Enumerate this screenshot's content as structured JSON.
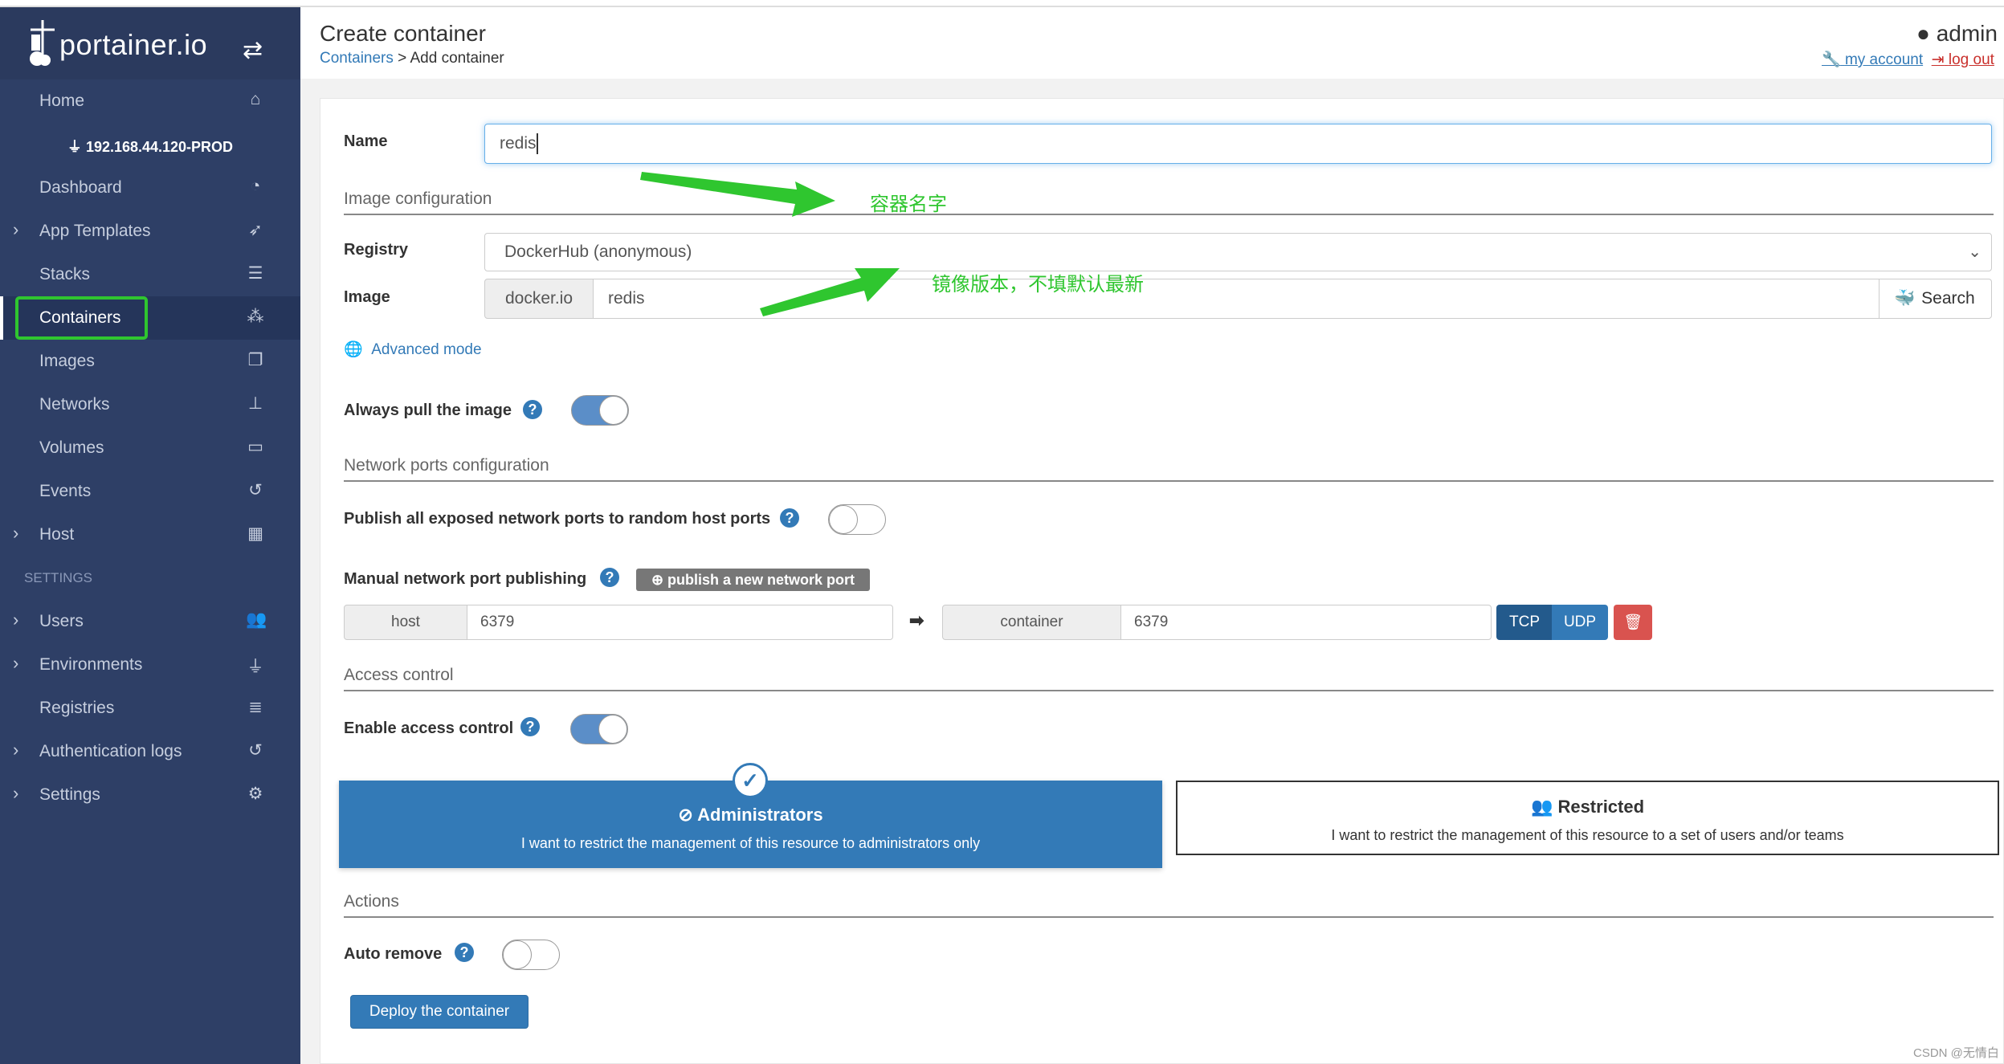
{
  "sidebar": {
    "logo": "portainer.io",
    "endpoint": "192.168.44.120-PROD",
    "items": [
      {
        "label": "Home",
        "icon": "home-icon",
        "glyph": "⌂"
      },
      {
        "label": "Dashboard",
        "icon": "tachometer-icon",
        "glyph": "◔"
      },
      {
        "label": "App Templates",
        "icon": "rocket-icon",
        "glyph": "➶"
      },
      {
        "label": "Stacks",
        "icon": "th-list-icon",
        "glyph": "☰"
      },
      {
        "label": "Containers",
        "icon": "cubes-icon",
        "glyph": "⁂"
      },
      {
        "label": "Images",
        "icon": "clone-icon",
        "glyph": "❐"
      },
      {
        "label": "Networks",
        "icon": "sitemap-icon",
        "glyph": "⊥"
      },
      {
        "label": "Volumes",
        "icon": "hdd-icon",
        "glyph": "▭"
      },
      {
        "label": "Events",
        "icon": "history-icon",
        "glyph": "↺"
      },
      {
        "label": "Host",
        "icon": "th-icon",
        "glyph": "▦"
      }
    ],
    "settings_header": "SETTINGS",
    "settings_items": [
      {
        "label": "Users",
        "icon": "users-icon",
        "glyph": "👥"
      },
      {
        "label": "Environments",
        "icon": "plug-icon",
        "glyph": "⏚"
      },
      {
        "label": "Registries",
        "icon": "database-icon",
        "glyph": "≣"
      },
      {
        "label": "Authentication logs",
        "icon": "history-icon",
        "glyph": "↺"
      },
      {
        "label": "Settings",
        "icon": "cogs-icon",
        "glyph": "⚙"
      }
    ]
  },
  "header": {
    "title": "Create container",
    "breadcrumb_link": "Containers",
    "breadcrumb_sep": " > ",
    "breadcrumb_current": "Add container",
    "user": "admin",
    "my_account": "my account",
    "log_out": "log out"
  },
  "form": {
    "name_label": "Name",
    "name_value": "redis",
    "image_section": "Image configuration",
    "registry_label": "Registry",
    "registry_value": "DockerHub (anonymous)",
    "image_label": "Image",
    "image_prefix": "docker.io",
    "image_value": "redis",
    "search_button": "Search",
    "advanced_mode": "Advanced mode",
    "always_pull_label": "Always pull the image",
    "always_pull": true,
    "network_section": "Network ports configuration",
    "publish_all_label": "Publish all exposed network ports to random host ports",
    "publish_all": false,
    "manual_label": "Manual network port publishing",
    "publish_button": "publish a new network port",
    "host_addon": "host",
    "host_port": "6379",
    "container_addon": "container",
    "container_port": "6379",
    "tcp": "TCP",
    "udp": "UDP",
    "protocol_selected": "TCP",
    "access_section": "Access control",
    "enable_access_label": "Enable access control",
    "enable_access": true,
    "admin_title": "Administrators",
    "admin_desc": "I want to restrict the management of this resource to administrators only",
    "restricted_title": "Restricted",
    "restricted_desc": "I want to restrict the management of this resource to a set of users and/or teams",
    "actions_section": "Actions",
    "auto_remove_label": "Auto remove",
    "auto_remove": false,
    "deploy_button": "Deploy the container"
  },
  "annotations": {
    "name_note": "容器名字",
    "image_note": "镜像版本，不填默认最新"
  },
  "watermark": "CSDN @无情白",
  "colors": {
    "sidebar": "#2e3f66",
    "primary": "#337ab7",
    "danger": "#d9534f",
    "annotation": "#2fc62f"
  }
}
